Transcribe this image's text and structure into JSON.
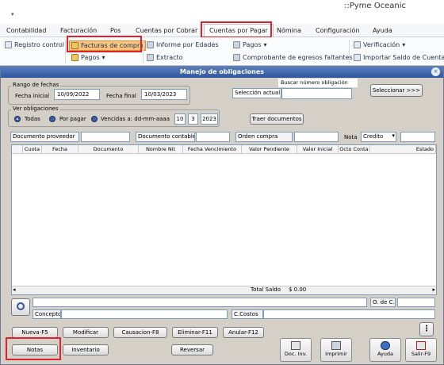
{
  "app": {
    "title": "::Pyme Oceanic",
    "quick_access_arrow": "▾"
  },
  "tabs": [
    {
      "label": "Contabilidad"
    },
    {
      "label": "Facturación"
    },
    {
      "label": "Pos"
    },
    {
      "label": "Cuentas por Cobrar"
    },
    {
      "label": "Cuentas por Pagar"
    },
    {
      "label": "Nómina"
    },
    {
      "label": "Configuración"
    },
    {
      "label": "Ayuda"
    }
  ],
  "ribbon": {
    "registro_control": "Registro control",
    "facturas_compra": "Facturas de compra",
    "pagos_left": "Pagos",
    "informe_edades": "Informe por Edades",
    "extracto": "Extracto",
    "pagos": "Pagos",
    "comprobante": "Comprobante de egresos faltantes",
    "verificacion": "Verificación",
    "importar": "Importar Saldo de Cuentas p"
  },
  "dialog": {
    "title": "Manejo de obligaciones",
    "close": "×",
    "rango": {
      "group_label": "Rango de fechas",
      "fecha_inicial_label": "Fecha inicial",
      "fecha_inicial": "10/09/2022",
      "fecha_final_label": "Fecha final",
      "fecha_final": "10/03/2023"
    },
    "buscar": {
      "label": "Buscar número obligación",
      "seleccion_label": "Selección actual",
      "seleccionar_button": "Seleccionar >>>"
    },
    "ver": {
      "group_label": "Ver obligaciones",
      "todas": "Todas",
      "por_pagar": "Por pagar",
      "vencidas": "Vencidas a: dd-mm-aaaa",
      "day": "10",
      "month": "3",
      "year": "2023",
      "traer_button": "Traer documentos"
    },
    "filters": {
      "doc_proveedor": "Documento proveedor",
      "doc_contable": "Documento contable",
      "orden_compra": "Orden compra",
      "nota": "Nota",
      "nota_value": "Credito",
      "nota_arrow": "▾"
    },
    "columns": [
      "Cuota",
      "Fecha",
      "Documento",
      "Nombre Nit",
      "Fecha Vencimiento",
      "Valor Pendiente",
      "Valor Inicial",
      "Octo Conta",
      "Estado"
    ],
    "total": {
      "label": "Total Saldo",
      "value": "$ 0.00"
    },
    "bottom": {
      "odec_label": "O. de C.",
      "concepto_label": "Concepto",
      "ccostos_label": "C.Costos"
    },
    "buttons": {
      "nueva": "Nueva-F5",
      "modificar": "Modificar",
      "causacion": "Causacion-F8",
      "eliminar": "Eliminar-F11",
      "anular": "Anular-F12",
      "notas": "Notas",
      "inventario": "Inventario",
      "reversar": "Reversar",
      "doc_inv": "Doc. Inv.",
      "imprimir": "Imprimir",
      "ayuda": "Ayuda",
      "salir": "Salir-F9",
      "more": "⋮"
    }
  },
  "colors": {
    "highlight": "#e0202a",
    "titlebar": "#2f55a0",
    "radio": "#3d5fa8"
  }
}
